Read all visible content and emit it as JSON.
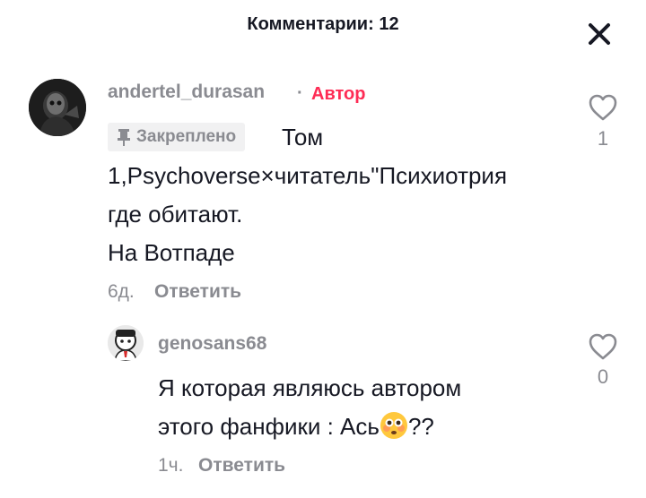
{
  "header": {
    "title": "Комментарии: 12"
  },
  "comments": [
    {
      "username": "andertel_durasan",
      "separator": "·",
      "author_tag": "Автор",
      "pinned_label": "Закреплено",
      "lines": [
        "Том",
        "1,Psychoverse×читатель\"Психиотрия",
        "где обитают.",
        "На Вотпаде"
      ],
      "time": "6д.",
      "reply_label": "Ответить",
      "likes": "1"
    },
    {
      "username": "genosans68",
      "lines": [
        "Я которая являюсь автором",
        "этого фанфики : Ась",
        "??"
      ],
      "time": "1ч.",
      "reply_label": "Ответить",
      "likes": "0"
    }
  ],
  "colors": {
    "accent": "#fe2c55",
    "muted": "#8a8b91",
    "text": "#161823",
    "badge_bg": "#f1f1f2"
  },
  "icons": {
    "close": "close-icon",
    "like": "heart-outline-icon",
    "pin": "pin-icon",
    "emoji": "flushed-face-emoji"
  }
}
